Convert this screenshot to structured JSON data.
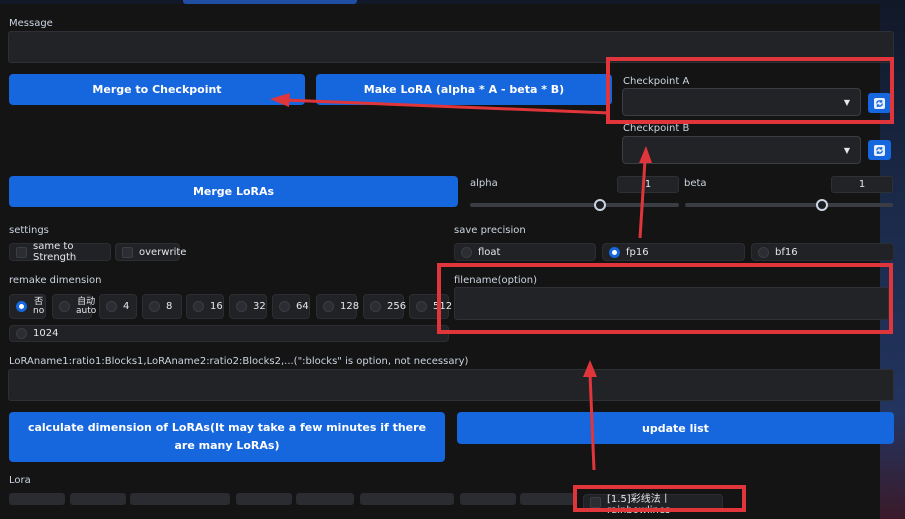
{
  "message": {
    "label": "Message",
    "value": ""
  },
  "buttons": {
    "merge_to_checkpoint": "Merge to Checkpoint",
    "make_lora": "Make LoRA (alpha * A - beta * B)",
    "merge_loras": "Merge LoRAs",
    "calculate_dimension": "calculate dimension of LoRAs(It may take a few minutes if there are many LoRAs)",
    "update_list": "update list"
  },
  "checkpoints": {
    "a_label": "Checkpoint A",
    "a_value": "",
    "b_label": "Checkpoint B",
    "b_value": "",
    "dropdown_glyph": "▼",
    "refresh_icon": "refresh-icon"
  },
  "alpha": {
    "label": "alpha",
    "value": "1",
    "slider_fraction": 0.62
  },
  "beta": {
    "label": "beta",
    "value": "1",
    "slider_fraction": 0.66
  },
  "settings": {
    "label": "settings",
    "options": [
      {
        "label": "same to Strength",
        "checked": false
      },
      {
        "label": "overwrite",
        "checked": false
      }
    ]
  },
  "save_precision": {
    "label": "save precision",
    "options": [
      {
        "label": "float",
        "selected": false
      },
      {
        "label": "fp16",
        "selected": true
      },
      {
        "label": "bf16",
        "selected": false
      }
    ]
  },
  "remake_dimension": {
    "label": "remake dimension",
    "options": [
      {
        "top": "否",
        "bottom": "no",
        "selected": true
      },
      {
        "top": "自动",
        "bottom": "auto",
        "selected": false
      },
      {
        "label": "4"
      },
      {
        "label": "8"
      },
      {
        "label": "16"
      },
      {
        "label": "32"
      },
      {
        "label": "64"
      },
      {
        "label": "128"
      },
      {
        "label": "256"
      },
      {
        "label": "512"
      },
      {
        "label": "1024"
      }
    ]
  },
  "filename": {
    "label": "filename(option)",
    "value": ""
  },
  "lora_names": {
    "label": "LoRAname1:ratio1:Blocks1,LoRAname2:ratio2:Blocks2,...(\":blocks\" is option, not necessary)",
    "value": ""
  },
  "lora": {
    "label": "Lora",
    "visible_item": "[1.5]彩线法丨rainbowlines"
  },
  "colors": {
    "accent": "#1666dd",
    "annotation": "#e0353b",
    "background": "#141414"
  }
}
